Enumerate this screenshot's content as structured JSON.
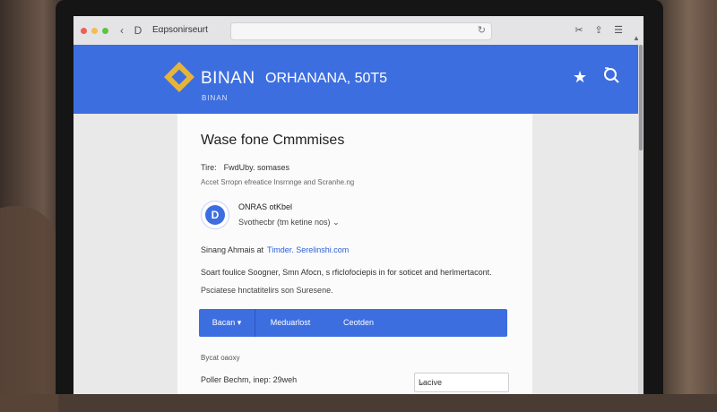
{
  "browser": {
    "tab_label": "Eαpsonirseurt",
    "back_glyph": "‹",
    "forward_glyph": "D"
  },
  "header": {
    "logo_text": "BINAN",
    "logo_subtext": "BINAN",
    "title": "ORHANANA, 50T5",
    "colors": {
      "banner": "#3d6ee0",
      "logo": "#e7b43a"
    }
  },
  "card": {
    "title": "Wase fone Cmmmises",
    "time_label": "Tire:",
    "time_value": "FwdUby. somases",
    "subtitle": "Accet Srropn efreatice Insrnnge and Scranhe.ng",
    "account": {
      "avatar_letter": "D",
      "name": "ONRAS otKbel",
      "selector": "Svothecbr (tm ketine nos)"
    },
    "link_label": "Sinang Ahmais at",
    "link_text": "Timder. Serelinshi.com",
    "desc_bold": "Soart foulice",
    "desc_text": "Soogner, Smn Afocn, s rficlofociepis in for soticet and herlmertacont.",
    "desc2": "Psciatese hnctatitelirs son Suresene.",
    "buttons": {
      "first": "Bacan",
      "second": "Meduarlost",
      "third": "Ceotden"
    },
    "section_label": "Bycat oaoxy",
    "perf_label": "Poller Bechm,",
    "perf_value": "inep: 29weh",
    "select_value": "Lacive"
  }
}
